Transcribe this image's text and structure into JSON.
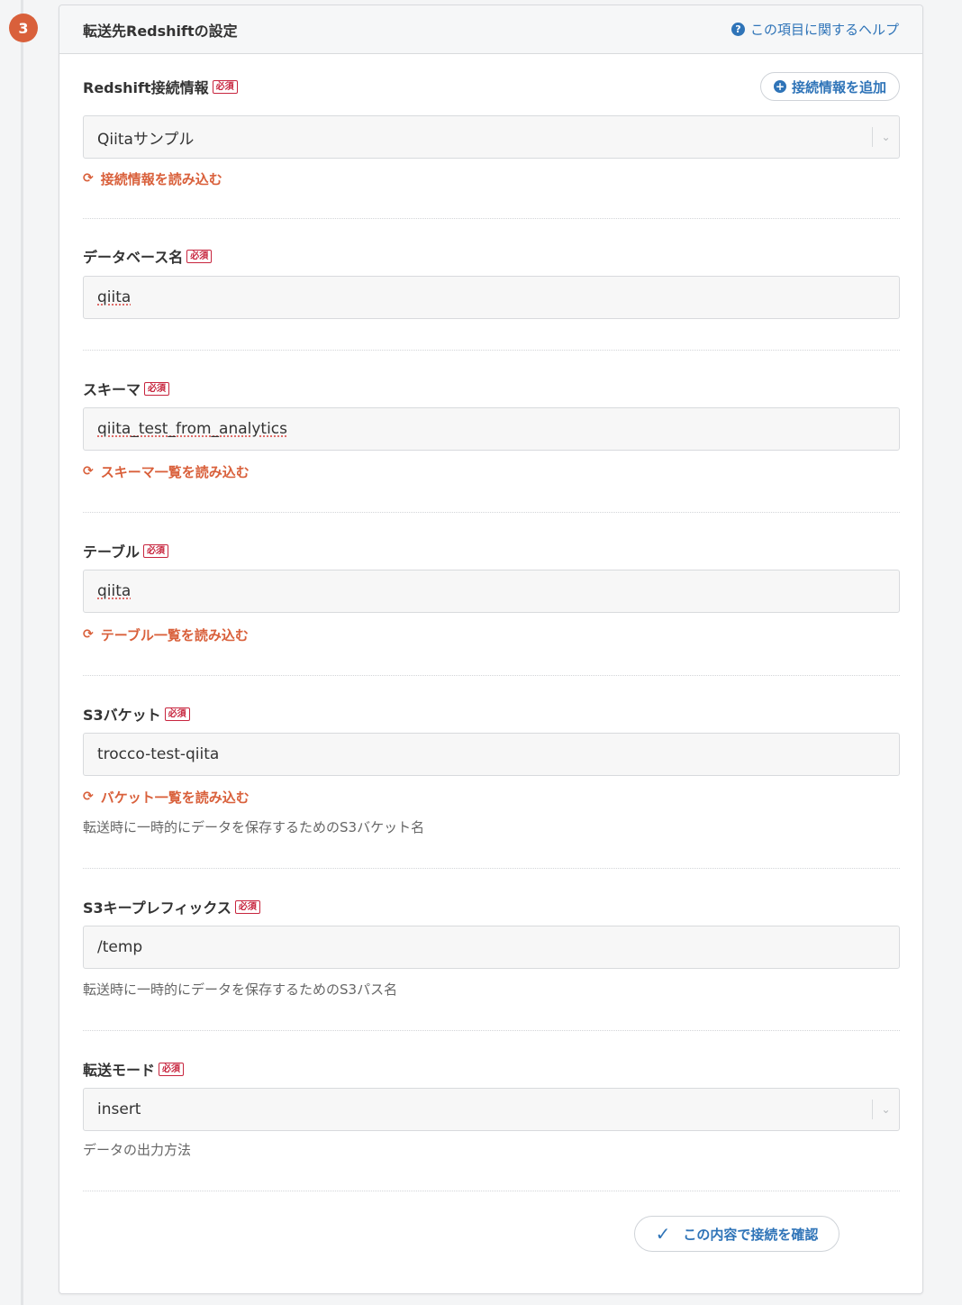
{
  "step": {
    "number": "3"
  },
  "panel": {
    "title": "転送先Redshiftの設定",
    "help_label": "この項目に関するヘルプ",
    "help_icon": "question-circle-icon"
  },
  "required_badge": "必須",
  "connection": {
    "label": "Redshift接続情報",
    "add_label": "接続情報を追加",
    "value": "Qiitaサンプル",
    "reload_label": "接続情報を読み込む"
  },
  "database": {
    "label": "データベース名",
    "value": "qiita"
  },
  "schema": {
    "label": "スキーマ",
    "value": "qiita_test_from_analytics",
    "reload_label": "スキーマ一覧を読み込む"
  },
  "table": {
    "label": "テーブル",
    "value": "qiita",
    "reload_label": "テーブル一覧を読み込む"
  },
  "bucket": {
    "label": "S3バケット",
    "value": "trocco-test-qiita",
    "reload_label": "バケット一覧を読み込む",
    "hint": "転送時に一時的にデータを保存するためのS3バケット名"
  },
  "prefix": {
    "label": "S3キープレフィックス",
    "value": "/temp",
    "hint": "転送時に一時的にデータを保存するためのS3パス名"
  },
  "mode": {
    "label": "転送モード",
    "value": "insert",
    "hint": "データの出力方法"
  },
  "confirm": {
    "label": "この内容で接続を確認"
  },
  "colors": {
    "accent": "#2f74b8",
    "link": "#d9603b",
    "required": "#c7253e",
    "step": "#d9603b"
  }
}
